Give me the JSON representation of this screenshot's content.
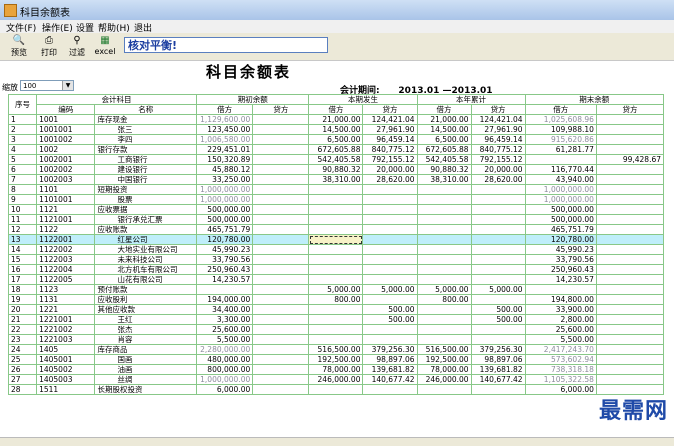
{
  "window": {
    "title": "科目余额表"
  },
  "menu": [
    "文件(F)",
    "操作(E)",
    "设置",
    "帮助(H)",
    "退出"
  ],
  "toolbar": {
    "buttons": [
      {
        "label": "预览",
        "icon": "preview-icon"
      },
      {
        "label": "打印",
        "icon": "print-icon"
      },
      {
        "label": "过滤",
        "icon": "filter-icon"
      },
      {
        "label": "excel",
        "icon": "excel-icon"
      }
    ],
    "status_text": "核对平衡!"
  },
  "report": {
    "title": "科目余额表",
    "period_label": "会计期间:",
    "period_value": "2013.01 —2013.01",
    "zoom_label": "缩放",
    "zoom_value": "100"
  },
  "headers": {
    "seq": "序号",
    "account": "会计科目",
    "code": "编码",
    "name": "名称",
    "opening": "期初余额",
    "current": "本期发生",
    "ytd": "本年累计",
    "closing": "期末余额",
    "debit": "借方",
    "credit": "贷方"
  },
  "rows": [
    [
      "1",
      "1001",
      "库存现金",
      "1,129,600.00",
      "",
      "21,000.00",
      "124,421.04",
      "21,000.00",
      "124,421.04",
      "1,025,608.96",
      ""
    ],
    [
      "2",
      "1001001",
      "张三",
      "123,450.00",
      "",
      "14,500.00",
      "27,961.90",
      "14,500.00",
      "27,961.90",
      "109,988.10",
      ""
    ],
    [
      "3",
      "1001002",
      "李四",
      "1,006,580.00",
      "",
      "6,500.00",
      "96,459.14",
      "6,500.00",
      "96,459.14",
      "915,620.86",
      ""
    ],
    [
      "4",
      "1002",
      "银行存款",
      "229,451.01",
      "",
      "672,605.88",
      "840,775.12",
      "672,605.88",
      "840,775.12",
      "61,281.77",
      ""
    ],
    [
      "5",
      "1002001",
      "工商银行",
      "150,320.89",
      "",
      "542,405.58",
      "792,155.12",
      "542,405.58",
      "792,155.12",
      "",
      "99,428.67"
    ],
    [
      "6",
      "1002002",
      "建设银行",
      "45,880.12",
      "",
      "90,880.32",
      "20,000.00",
      "90,880.32",
      "20,000.00",
      "116,770.44",
      ""
    ],
    [
      "7",
      "1002003",
      "中国银行",
      "33,250.00",
      "",
      "38,310.00",
      "28,620.00",
      "38,310.00",
      "28,620.00",
      "43,940.00",
      ""
    ],
    [
      "8",
      "1101",
      "短期投资",
      "1,000,000.00",
      "",
      "",
      "",
      "",
      "",
      "1,000,000.00",
      ""
    ],
    [
      "9",
      "1101001",
      "股票",
      "1,000,000.00",
      "",
      "",
      "",
      "",
      "",
      "1,000,000.00",
      ""
    ],
    [
      "10",
      "1121",
      "应收票据",
      "500,000.00",
      "",
      "",
      "",
      "",
      "",
      "500,000.00",
      ""
    ],
    [
      "11",
      "1121001",
      "银行承兑汇票",
      "500,000.00",
      "",
      "",
      "",
      "",
      "",
      "500,000.00",
      ""
    ],
    [
      "12",
      "1122",
      "应收账款",
      "465,751.79",
      "",
      "",
      "",
      "",
      "",
      "465,751.79",
      ""
    ],
    [
      "13",
      "1122001",
      "红星公司",
      "120,780.00",
      "",
      "",
      "",
      "",
      "",
      "120,780.00",
      ""
    ],
    [
      "14",
      "1122002",
      "大地实业有限公司",
      "45,990.23",
      "",
      "",
      "",
      "",
      "",
      "45,990.23",
      ""
    ],
    [
      "15",
      "1122003",
      "未来科技公司",
      "33,790.56",
      "",
      "",
      "",
      "",
      "",
      "33,790.56",
      ""
    ],
    [
      "16",
      "1122004",
      "北方机车有限公司",
      "250,960.43",
      "",
      "",
      "",
      "",
      "",
      "250,960.43",
      ""
    ],
    [
      "17",
      "1122005",
      "山花有限公司",
      "14,230.57",
      "",
      "",
      "",
      "",
      "",
      "14,230.57",
      ""
    ],
    [
      "18",
      "1123",
      "预付账款",
      "",
      "",
      "5,000.00",
      "5,000.00",
      "5,000.00",
      "5,000.00",
      "",
      ""
    ],
    [
      "19",
      "1131",
      "应收股利",
      "194,000.00",
      "",
      "800.00",
      "",
      "800.00",
      "",
      "194,800.00",
      ""
    ],
    [
      "20",
      "1221",
      "其他应收款",
      "34,400.00",
      "",
      "",
      "500.00",
      "",
      "500.00",
      "33,900.00",
      ""
    ],
    [
      "21",
      "1221001",
      "王红",
      "3,300.00",
      "",
      "",
      "500.00",
      "",
      "500.00",
      "2,800.00",
      ""
    ],
    [
      "22",
      "1221002",
      "张杰",
      "25,600.00",
      "",
      "",
      "",
      "",
      "",
      "25,600.00",
      ""
    ],
    [
      "23",
      "1221003",
      "肖容",
      "5,500.00",
      "",
      "",
      "",
      "",
      "",
      "5,500.00",
      ""
    ],
    [
      "24",
      "1405",
      "库存商品",
      "2,280,000.00",
      "",
      "516,500.00",
      "379,256.30",
      "516,500.00",
      "379,256.30",
      "2,417,243.70",
      ""
    ],
    [
      "25",
      "1405001",
      "国画",
      "480,000.00",
      "",
      "192,500.00",
      "98,897.06",
      "192,500.00",
      "98,897.06",
      "573,602.94",
      ""
    ],
    [
      "26",
      "1405002",
      "油画",
      "800,000.00",
      "",
      "78,000.00",
      "139,681.82",
      "78,000.00",
      "139,681.82",
      "738,318.18",
      ""
    ],
    [
      "27",
      "1405003",
      "丝绸",
      "1,000,000.00",
      "",
      "246,000.00",
      "140,677.42",
      "246,000.00",
      "140,677.42",
      "1,105,322.58",
      ""
    ],
    [
      "28",
      "1511",
      "长期股权投资",
      "6,000.00",
      "",
      "",
      "",
      "",
      "",
      "6,000.00",
      ""
    ]
  ],
  "faint_cells": [
    [
      0,
      3
    ],
    [
      0,
      9
    ],
    [
      2,
      3
    ],
    [
      2,
      9
    ],
    [
      7,
      3
    ],
    [
      7,
      9
    ],
    [
      8,
      3
    ],
    [
      8,
      9
    ],
    [
      23,
      3
    ],
    [
      23,
      9
    ],
    [
      24,
      9
    ],
    [
      25,
      9
    ],
    [
      26,
      3
    ],
    [
      26,
      9
    ]
  ],
  "selected_row": 12,
  "watermark": "最需网"
}
